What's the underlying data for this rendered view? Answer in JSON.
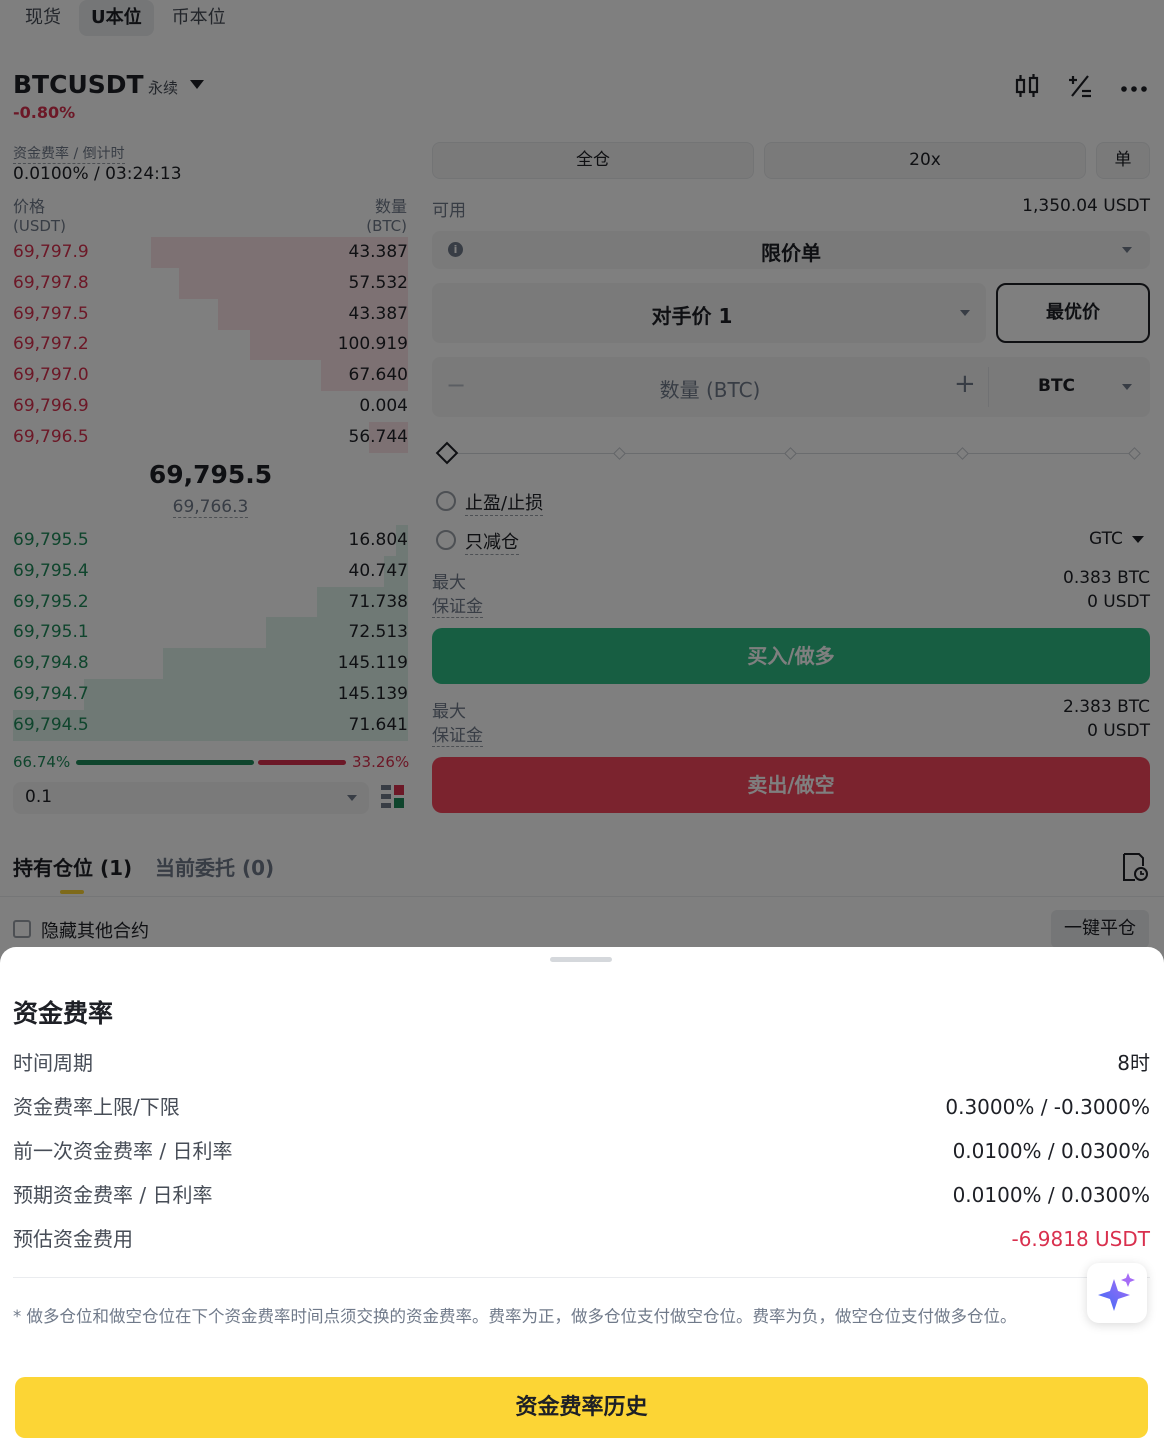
{
  "top_tabs": [
    {
      "label": "现货",
      "active": false
    },
    {
      "label": "U本位",
      "active": true
    },
    {
      "label": "币本位",
      "active": false
    }
  ],
  "header": {
    "symbol": "BTCUSDT",
    "contract_type": "永续",
    "change": "-0.80%",
    "funding_label": "资金费率 / 倒计时",
    "funding_value": "0.0100% / 03:24:13"
  },
  "orderbook": {
    "price_header": "价格",
    "price_unit": "(USDT)",
    "qty_header": "数量",
    "qty_unit": "(BTC)",
    "asks": [
      {
        "price": "69,797.9",
        "qty": "43.387",
        "depth": 0.65
      },
      {
        "price": "69,797.8",
        "qty": "57.532",
        "depth": 0.58
      },
      {
        "price": "69,797.5",
        "qty": "43.387",
        "depth": 0.48
      },
      {
        "price": "69,797.2",
        "qty": "100.919",
        "depth": 0.4
      },
      {
        "price": "69,797.0",
        "qty": "67.640",
        "depth": 0.22
      },
      {
        "price": "69,796.9",
        "qty": "0.004",
        "depth": 0.0
      },
      {
        "price": "69,796.5",
        "qty": "56.744",
        "depth": 0.1
      }
    ],
    "last_price": "69,795.5",
    "mark_price": "69,766.3",
    "bids": [
      {
        "price": "69,795.5",
        "qty": "16.804",
        "depth": 0.03
      },
      {
        "price": "69,795.4",
        "qty": "40.747",
        "depth": 0.06
      },
      {
        "price": "69,795.2",
        "qty": "71.738",
        "depth": 0.23
      },
      {
        "price": "69,795.1",
        "qty": "72.513",
        "depth": 0.36
      },
      {
        "price": "69,794.8",
        "qty": "145.119",
        "depth": 0.62
      },
      {
        "price": "69,794.7",
        "qty": "145.139",
        "depth": 0.82
      },
      {
        "price": "69,794.5",
        "qty": "71.641",
        "depth": 1.0
      }
    ],
    "buy_ratio": "66.74%",
    "sell_ratio": "33.26%",
    "buy_fraction": 0.6674,
    "precision": "0.1"
  },
  "order_form": {
    "margin_mode": "全仓",
    "leverage": "20x",
    "position_mode": "单",
    "available_label": "可用",
    "available_value": "1,350.04 USDT",
    "order_type": "限价单",
    "price_type": "对手价 1",
    "best_price": "最优价",
    "quantity_placeholder": "数量 (BTC)",
    "quantity_unit": "BTC",
    "tp_sl": "止盈/止损",
    "reduce_only": "只减仓",
    "tif": "GTC",
    "max_label": "最大",
    "margin_label": "保证金",
    "buy_max": "0.383 BTC",
    "buy_margin": "0 USDT",
    "buy_button": "买入/做多",
    "sell_max": "2.383 BTC",
    "sell_margin": "0 USDT",
    "sell_button": "卖出/做空"
  },
  "positions": {
    "tab_positions": "持有仓位 (1)",
    "tab_orders": "当前委托 (0)",
    "hide_others": "隐藏其他合约",
    "close_all": "一键平仓"
  },
  "sheet": {
    "title": "资金费率",
    "rows": [
      {
        "label": "时间周期",
        "value": "8时",
        "red": false
      },
      {
        "label": "资金费率上限/下限",
        "value": "0.3000% / -0.3000%",
        "red": false
      },
      {
        "label": "前一次资金费率 / 日利率",
        "value": "0.0100% / 0.0300%",
        "red": false
      },
      {
        "label": "预期资金费率 / 日利率",
        "value": "0.0100% / 0.0300%",
        "red": false
      },
      {
        "label": "预估资金费用",
        "value": "-6.9818 USDT",
        "red": true
      }
    ],
    "note": "* 做多仓位和做空仓位在下个资金费率时间点须交换的资金费率。费率为正，做多仓位支付做空仓位。费率为负，做空仓位支付做多仓位。",
    "history_button": "资金费率历史"
  },
  "colors": {
    "buy": "#1f8b5a",
    "sell": "#d9304e",
    "accent": "#fcd535"
  }
}
